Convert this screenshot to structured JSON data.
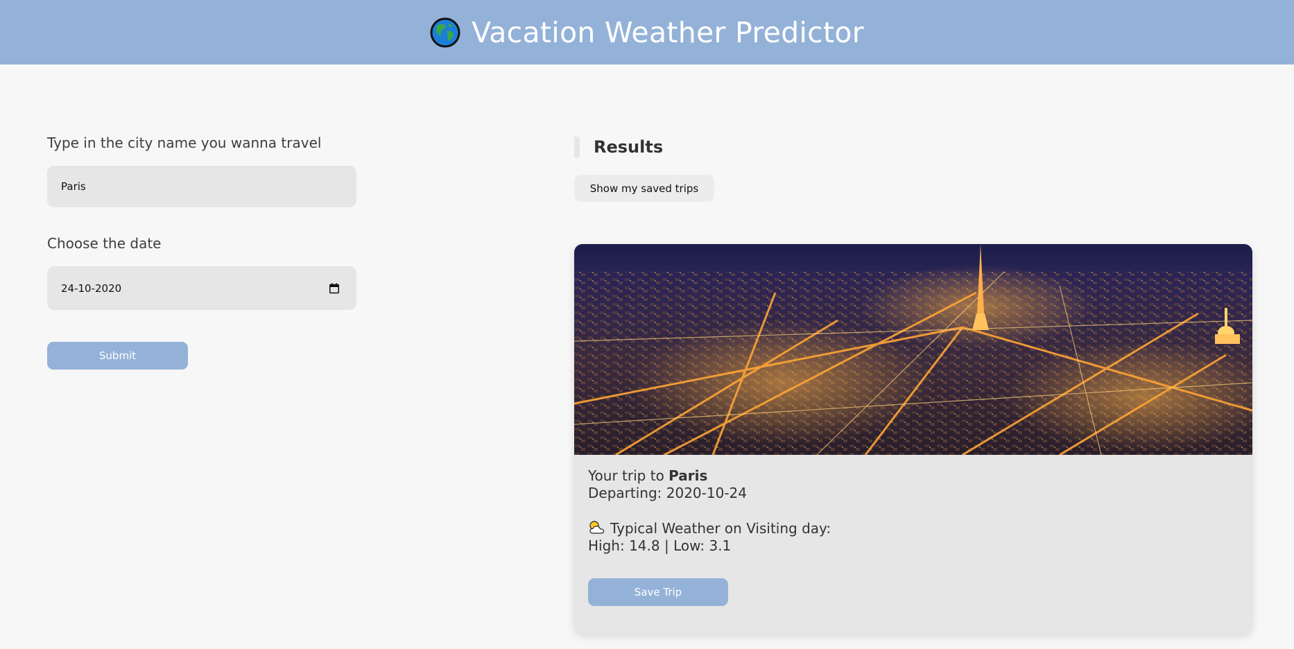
{
  "header": {
    "title": "Vacation Weather Predictor",
    "globe_icon": "globe-icon"
  },
  "form": {
    "city_label": "Type in the city name you wanna travel",
    "city_value": "Paris",
    "date_label": "Choose the date",
    "date_value": "24-10-2020",
    "calendar_icon": "calendar-icon",
    "submit_label": "Submit"
  },
  "results": {
    "title": "Results",
    "saved_trips_label": "Show my saved trips"
  },
  "trip_card": {
    "image": "Paris night cityscape with Eiffel Tower",
    "trip_prefix": "Your trip to",
    "city": "Paris",
    "departing_label": "Departing:",
    "departing_date": "2020-10-24",
    "weather_icon": "sun-behind-cloud-icon",
    "weather_heading": "Typical Weather on Visiting day:",
    "high_label": "High:",
    "high_value": "14.8",
    "low_label": "Low:",
    "low_value": "3.1",
    "save_label": "Save Trip"
  },
  "colors": {
    "accent": "#94b2d8",
    "background": "#f7f7f7",
    "field": "#e6e6e6"
  }
}
